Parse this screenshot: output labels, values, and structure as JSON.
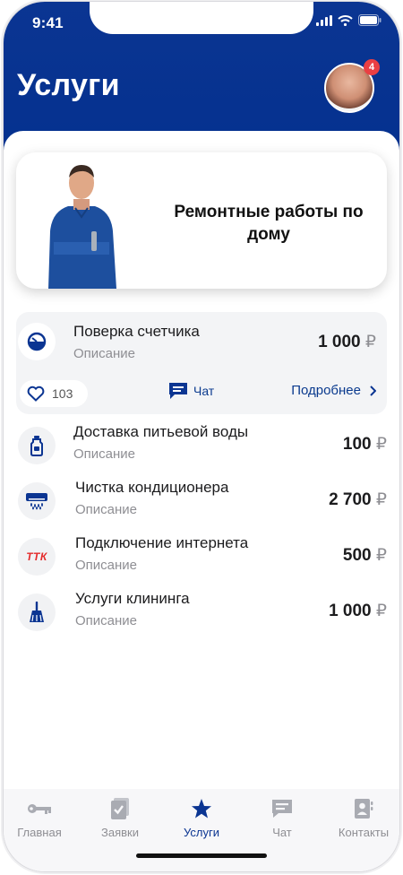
{
  "status": {
    "time": "9:41"
  },
  "header": {
    "title": "Услуги",
    "notification_count": "4"
  },
  "promo": {
    "text": "Ремонтные работы по дому"
  },
  "featured": {
    "title": "Поверка счетчика",
    "description": "Описание",
    "price": "1 000",
    "currency": "₽",
    "likes": "103",
    "chat_label": "Чат",
    "more_label": "Подробнее"
  },
  "services": [
    {
      "title": "Доставка питьевой воды",
      "description": "Описание",
      "price": "100",
      "currency": "₽",
      "icon": "water-bottle-icon"
    },
    {
      "title": "Чистка кондиционера",
      "description": "Описание",
      "price": "2 700",
      "currency": "₽",
      "icon": "air-conditioner-icon"
    },
    {
      "title": "Подключение интернета",
      "description": "Описание",
      "price": "500",
      "currency": "₽",
      "icon": "ttk-logo",
      "logo_text": "ТТК"
    },
    {
      "title": "Услуги клининга",
      "description": "Описание",
      "price": "1 000",
      "currency": "₽",
      "icon": "broom-icon"
    }
  ],
  "tabbar": {
    "items": [
      {
        "label": "Главная",
        "icon": "key-icon",
        "active": false
      },
      {
        "label": "Заявки",
        "icon": "checklist-icon",
        "active": false
      },
      {
        "label": "Услуги",
        "icon": "star-icon",
        "active": true
      },
      {
        "label": "Чат",
        "icon": "chat-icon",
        "active": false
      },
      {
        "label": "Контакты",
        "icon": "contacts-icon",
        "active": false
      }
    ]
  },
  "colors": {
    "primary": "#0b3592",
    "badge": "#ea3f43",
    "muted": "#8e8e93",
    "ttk_red": "#e42a2a"
  }
}
